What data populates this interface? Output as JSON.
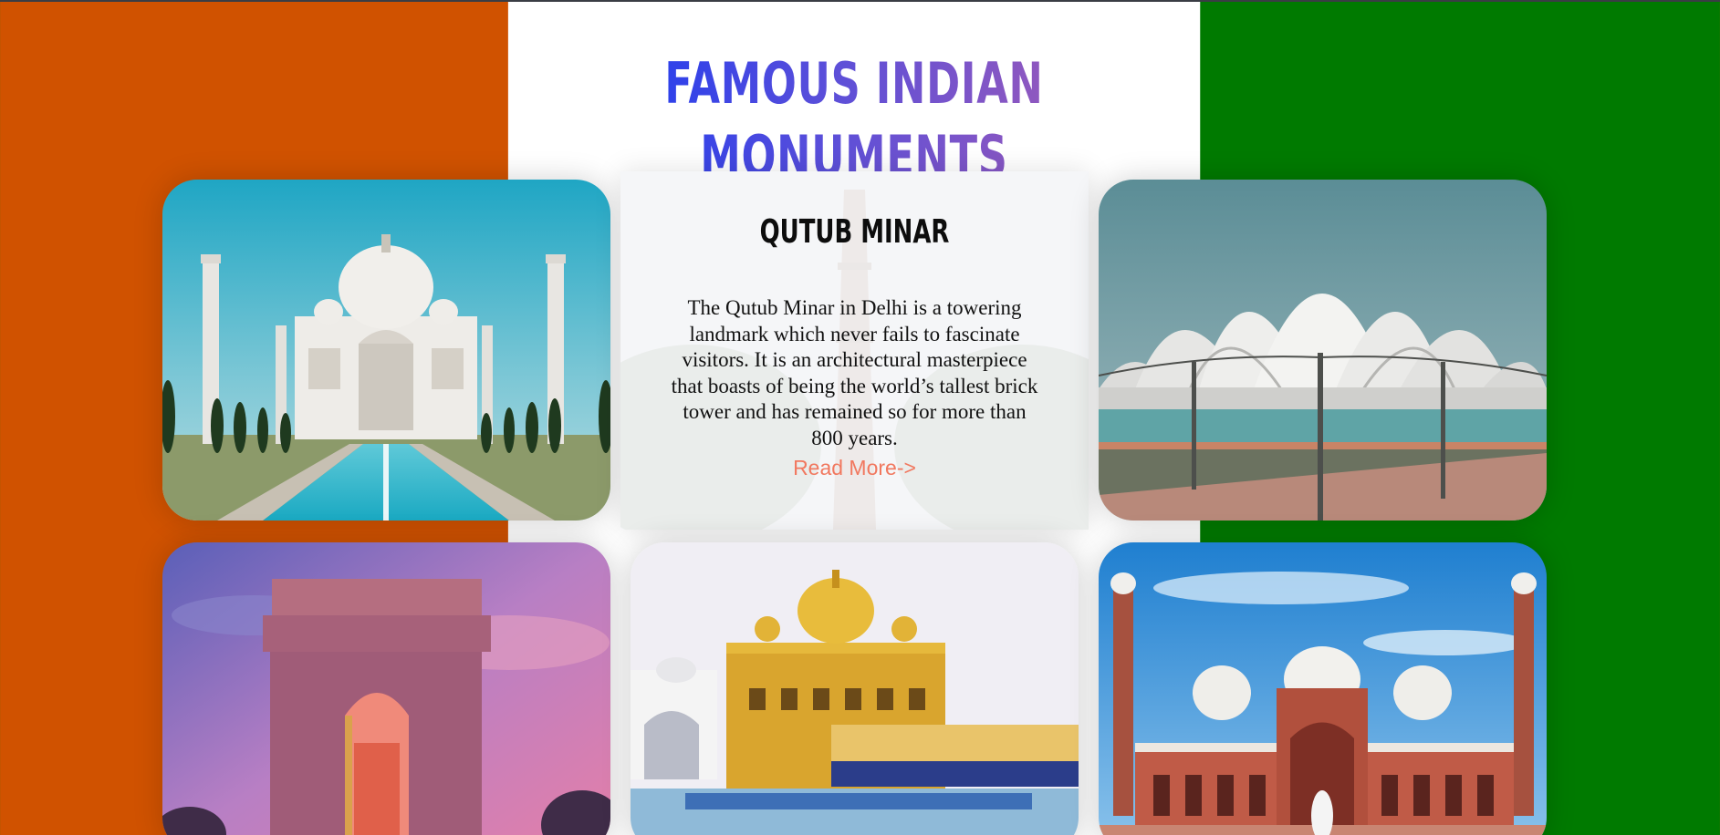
{
  "page": {
    "title": "FAMOUS INDIAN MONUMENTS",
    "colors": {
      "saffron": "#d05200",
      "white": "#ffffff",
      "green": "#007a00",
      "title_gradient_start": "#1f3cf0",
      "title_gradient_end": "#9d5ab8",
      "link": "#f1785f"
    }
  },
  "featured": {
    "title": "QUTUB MINAR",
    "description": "The Qutub Minar in Delhi is a towering landmark which never fails to fascinate visitors. It is an architectural masterpiece that boasts of being the world’s tallest brick tower and has remained so for more than 800 years.",
    "link_label": "Read More->"
  },
  "cards": [
    {
      "id": "taj-mahal",
      "image": "taj-mahal-image"
    },
    {
      "id": "qutub-minar",
      "image": "qutub-minar-image"
    },
    {
      "id": "lotus-temple",
      "image": "lotus-temple-image"
    },
    {
      "id": "india-gate",
      "image": "india-gate-image"
    },
    {
      "id": "golden-temple",
      "image": "golden-temple-image"
    },
    {
      "id": "jama-masjid",
      "image": "jama-masjid-image"
    }
  ]
}
